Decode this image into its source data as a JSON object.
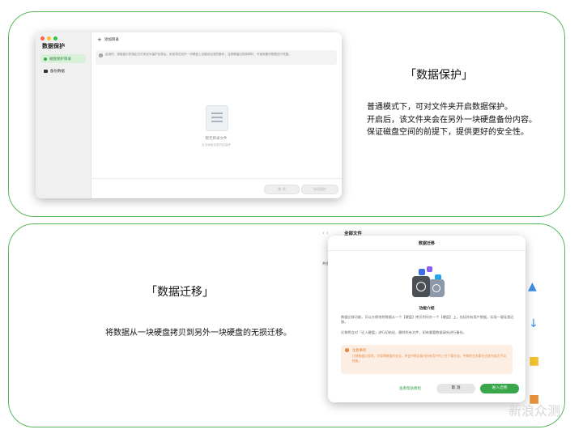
{
  "protection_window": {
    "app_title": "数据保护",
    "sidebar_items": [
      {
        "label": "磁盘保护目录",
        "icon": "protect-dot-icon",
        "selected": true
      },
      {
        "label": "备份数据",
        "icon": "folder-icon",
        "selected": false
      }
    ],
    "add_button": "添加目录",
    "info_text": "启用时，将磁盘中的指定文件夹设为保护目录后，系统将在另外一块硬盘上创建该目录的备份，当原硬盘出现故障时，可使用备份数据进行恢复。",
    "empty_title": "暂无目录文件",
    "empty_subtitle": "点击添加目录开启保护",
    "cancel_button": "取 消",
    "start_button": "启动保护"
  },
  "protection_section": {
    "heading": "「数据保护」",
    "lines": [
      "普通模式下，可对文件夹开启数据保护。",
      "开启后，该文件夹会在另外一块硬盘备份内容。",
      "保证磁盘空间的前提下，提供更好的安全性。"
    ]
  },
  "migration_section": {
    "heading": "「数据迁移」",
    "description": "将数据从一块硬盘拷贝到另外一块硬盘的无损迁移。"
  },
  "files_window": {
    "nav": "‹ ›",
    "title": "全部文件",
    "side_label": "共名"
  },
  "migration_dialog": {
    "title": "数据迁移",
    "feature_title": "功能介绍",
    "text1": "数据迁移功能，可以方便地将数据从一个【硬盘】拷贝到另外一个【硬盘】上，包括所有用户数据，实现一键无损迁移。",
    "text2": "迁移将会对「迁入硬盘」进行初始化，删除所有文件，如有重要数据请先进行备份。",
    "warning_title": "注意事项",
    "warning_body": "迁移数据过程时，为保障数据的安全，将会中断设备内所有用户的上传下载任务，中断的任务需在迁移完成后手动恢复。",
    "help_link": "查看帮助教程",
    "cancel_button": "取 消",
    "confirm_button": "进入迁移"
  },
  "watermark": "新浪众测",
  "colors": {
    "accent": "#3aa64a",
    "warning": "#e37b2c",
    "border": "#5cb85c"
  }
}
